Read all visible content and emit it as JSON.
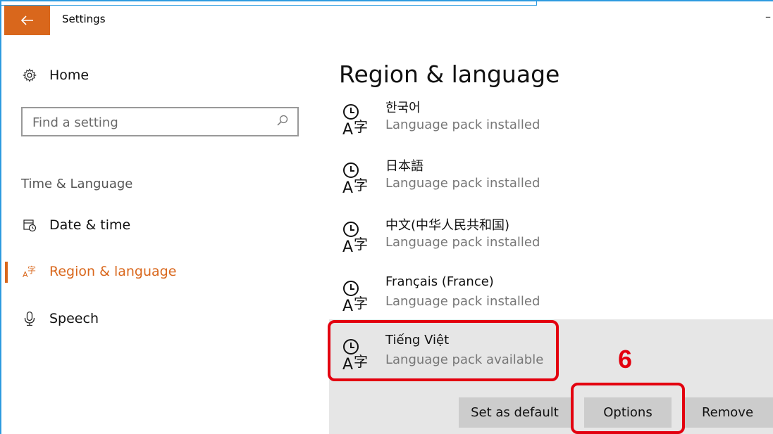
{
  "window": {
    "title": "Settings",
    "back_icon": "arrow-left-icon",
    "minimize_glyph": "–"
  },
  "sidebar": {
    "home_label": "Home",
    "search_placeholder": "Find a setting",
    "section_header": "Time & Language",
    "items": [
      {
        "label": "Date & time",
        "icon": "calendar-clock-icon",
        "active": false
      },
      {
        "label": "Region & language",
        "icon": "language-icon",
        "active": true
      },
      {
        "label": "Speech",
        "icon": "microphone-icon",
        "active": false
      }
    ]
  },
  "main": {
    "title": "Region & language",
    "languages": [
      {
        "name": "한국어",
        "status": "Language pack installed"
      },
      {
        "name": "日本語",
        "status": "Language pack installed"
      },
      {
        "name": "中文(中华人民共和国)",
        "status": "Language pack installed"
      },
      {
        "name": "Français (France)",
        "status": "Language pack installed"
      },
      {
        "name": "Tiếng Việt",
        "status": "Language pack available",
        "selected": true
      }
    ],
    "buttons": {
      "set_default": "Set as default",
      "options": "Options",
      "remove": "Remove"
    }
  },
  "annotation": {
    "step_number": "6",
    "color": "#e3000f"
  },
  "colors": {
    "accent": "#d9671c",
    "frame": "#2d9be0",
    "selected_bg": "#e6e6e6",
    "button_bg": "#cccccc"
  }
}
